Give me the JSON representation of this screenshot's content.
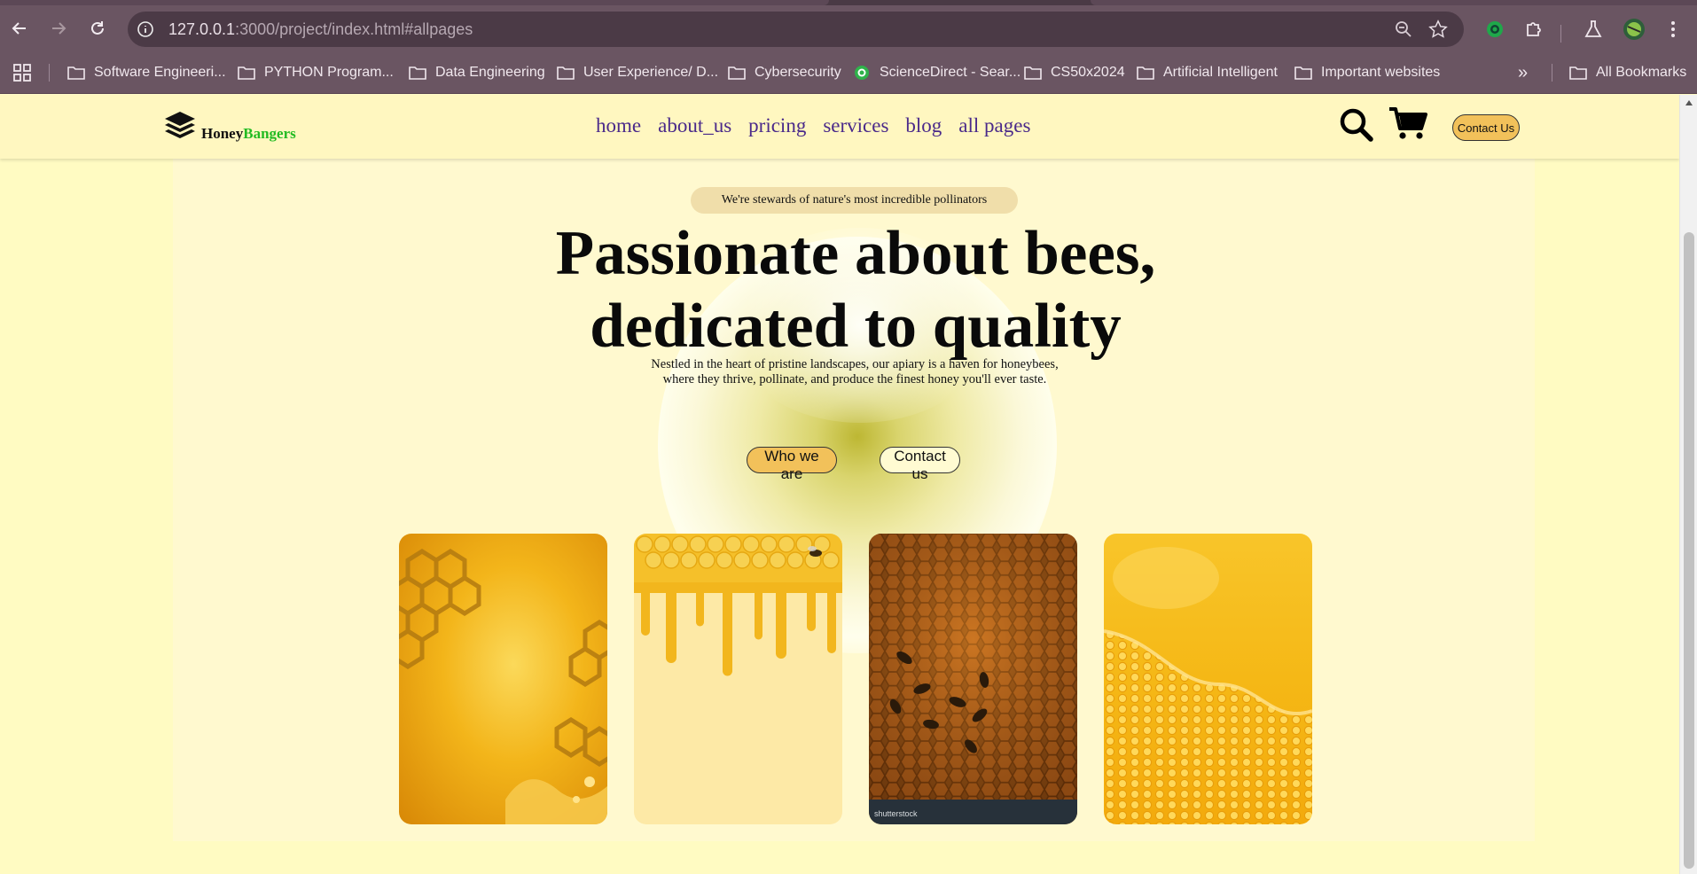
{
  "browser": {
    "url_host": "127.0.0.1",
    "url_path": ":3000/project/index.html#allpages",
    "bookmarks": [
      "Software Engineeri...",
      "PYTHON Program...",
      "Data Engineering",
      "User Experience/ D...",
      "Cybersecurity",
      "ScienceDirect - Sear...",
      "CS50x2024",
      "Artificial Intelligent",
      "Important websites"
    ],
    "overflow_label": "»",
    "all_bookmarks": "All Bookmarks"
  },
  "site": {
    "brand_part1": "Honey",
    "brand_part2": "Bangers",
    "nav": [
      "home",
      "about_us",
      "pricing",
      "services",
      "blog",
      "all pages"
    ],
    "contact_button": "Contact Us"
  },
  "hero": {
    "tagline": "We're stewards of nature's most incredible pollinators",
    "title_line1": "Passionate about bees,",
    "title_line2": "dedicated to quality",
    "text_line1": "Nestled in the heart of pristine landscapes, our apiary is a haven for honeybees,",
    "text_line2": "where they thrive, pollinate, and produce the finest honey you'll ever taste.",
    "btn_primary": "Who we are",
    "btn_secondary": "Contact us"
  },
  "cards": [
    {
      "name": "honeycomb-splash-image"
    },
    {
      "name": "dripping-honey-image"
    },
    {
      "name": "bees-on-comb-image",
      "caption": "shutterstock"
    },
    {
      "name": "honeycomb-pattern-image"
    }
  ],
  "colors": {
    "accent": "#f2c15a",
    "brand_green": "#22bb22",
    "nav_link": "#4a2a8a",
    "page_bg": "#fffbc2"
  }
}
